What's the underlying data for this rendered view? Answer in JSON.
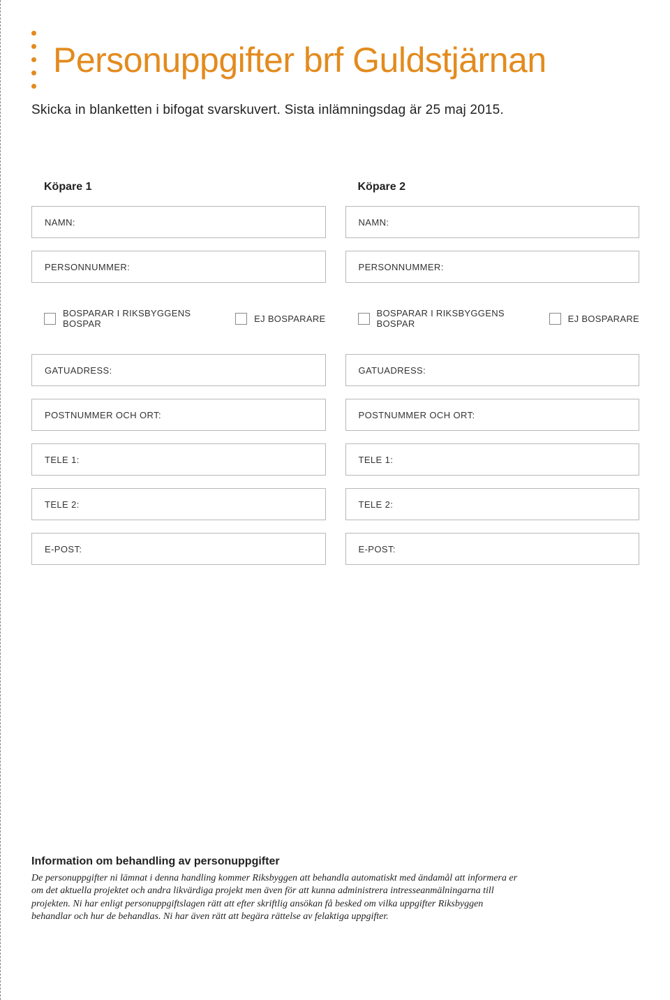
{
  "title": "Personuppgifter brf Guldstjärnan",
  "subtitle": "Skicka in blanketten i bifogat svarskuvert. Sista inlämningsdag är 25 maj 2015.",
  "buyer1": {
    "heading": "Köpare 1",
    "name_label": "NAMN:",
    "pnr_label": "PERSONNUMMER:",
    "bospar_label": "BOSPARAR I RIKSBYGGENS BOSPAR",
    "ejbospar_label": "EJ BOSPARARE",
    "street_label": "GATUADRESS:",
    "postal_label": "POSTNUMMER OCH ORT:",
    "tele1_label": "TELE 1:",
    "tele2_label": "TELE 2:",
    "email_label": "E-POST:"
  },
  "buyer2": {
    "heading": "Köpare 2",
    "name_label": "NAMN:",
    "pnr_label": "PERSONNUMMER:",
    "bospar_label": "BOSPARAR I RIKSBYGGENS BOSPAR",
    "ejbospar_label": "EJ BOSPARARE",
    "street_label": "GATUADRESS:",
    "postal_label": "POSTNUMMER OCH ORT:",
    "tele1_label": "TELE 1:",
    "tele2_label": "TELE 2:",
    "email_label": "E-POST:"
  },
  "info": {
    "heading": "Information om behandling av personuppgifter",
    "text": "De personuppgifter ni lämnat i denna handling kommer Riksbyggen att behandla automatiskt med ändamål att informera er om det aktuella projektet och andra likvärdiga projekt men även för att kunna administrera intresseanmälningarna till projekten. Ni har enligt personuppgiftslagen rätt att efter skriftlig ansökan få besked om vilka uppgifter Riksbyggen behandlar och hur de behandlas. Ni har även rätt att begära rättelse av felaktiga uppgifter."
  }
}
